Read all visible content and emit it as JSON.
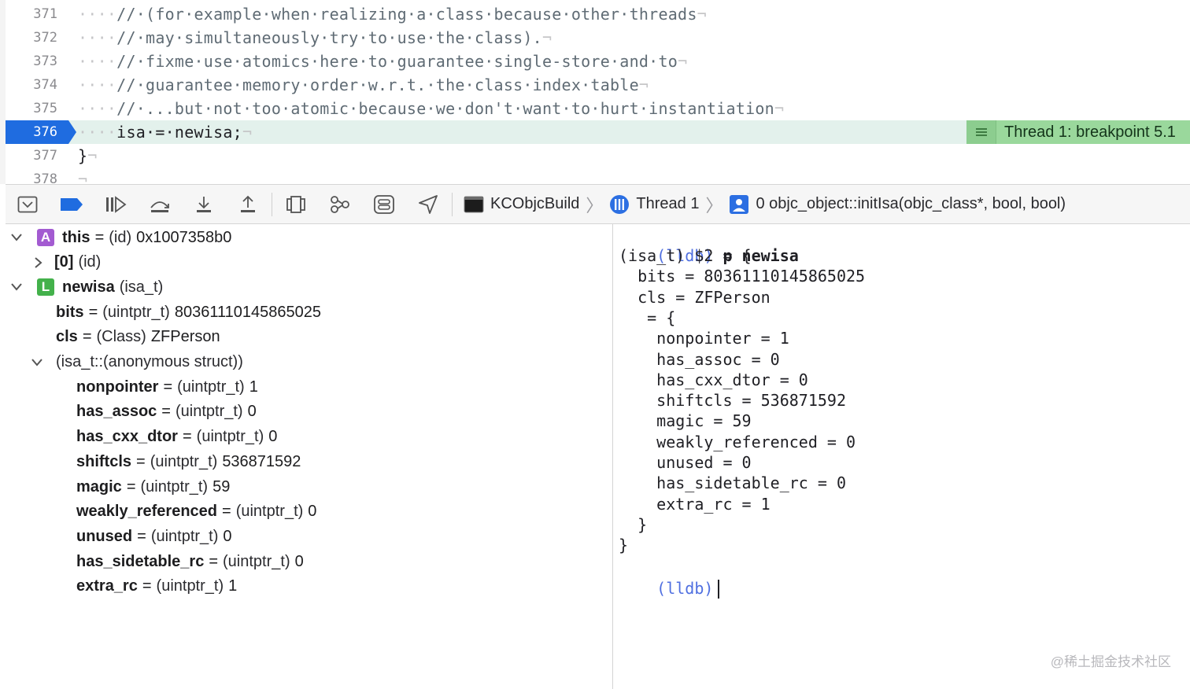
{
  "editor": {
    "lines": [
      {
        "num": "371",
        "indent": "····",
        "code": "//·(for·example·when·realizing·a·class·because·other·threads",
        "eol": "¬"
      },
      {
        "num": "372",
        "indent": "····",
        "code": "//·may·simultaneously·try·to·use·the·class).",
        "eol": "¬"
      },
      {
        "num": "373",
        "indent": "····",
        "code": "//·fixme·use·atomics·here·to·guarantee·single-store·and·to",
        "eol": "¬"
      },
      {
        "num": "374",
        "indent": "····",
        "code": "//·guarantee·memory·order·w.r.t.·the·class·index·table",
        "eol": "¬"
      },
      {
        "num": "375",
        "indent": "····",
        "code": "//·...but·not·too·atomic·because·we·don't·want·to·hurt·instantiation",
        "eol": "¬"
      },
      {
        "num": "376",
        "indent": "····",
        "code": "isa·=·newisa;",
        "eol": "¬"
      },
      {
        "num": "377",
        "indent": "",
        "code": "}",
        "eol": "¬"
      },
      {
        "num": "378",
        "indent": "",
        "code": "",
        "eol": "¬"
      }
    ],
    "current_line": "376",
    "breakpoint_label": "Thread 1: breakpoint 5.1",
    "colors": {
      "accent": "#1f6ce0",
      "current_line_bg": "#e3f1ec",
      "annotation_bg": "#9ad89c"
    }
  },
  "debugbar": {
    "buttons": [
      {
        "name": "hide-debug-area-button",
        "icon": "hide-debug-area-icon"
      },
      {
        "name": "toggle-breakpoints-button",
        "icon": "breakpoint-icon"
      },
      {
        "name": "continue-button",
        "icon": "continue-icon"
      },
      {
        "name": "step-over-button",
        "icon": "step-over-icon"
      },
      {
        "name": "step-into-button",
        "icon": "step-into-icon"
      },
      {
        "name": "step-out-button",
        "icon": "step-out-icon"
      },
      {
        "name": "view-debugger-button",
        "icon": "view-debugger-icon"
      },
      {
        "name": "memory-graph-button",
        "icon": "memory-graph-icon"
      },
      {
        "name": "environment-overrides-button",
        "icon": "environment-overrides-icon"
      },
      {
        "name": "simulate-location-button",
        "icon": "location-icon"
      }
    ],
    "breadcrumb": {
      "target": "KCObjcBuild",
      "thread": "Thread 1",
      "frame": "0 objc_object::initIsa(objc_class*, bool, bool)"
    }
  },
  "variables": [
    {
      "badge": "A",
      "name": "this",
      "type": "(id)",
      "value": "0x1007358b0",
      "expanded": true
    },
    {
      "name": "[0]",
      "type": "(id)",
      "value": "",
      "expanded": false
    },
    {
      "badge": "L",
      "name": "newisa",
      "type": "(isa_t)",
      "value": "",
      "expanded": true
    },
    {
      "name": "bits",
      "type": "(uintptr_t)",
      "value": "8036111014586502​5"
    },
    {
      "name": "cls",
      "type": "(Class)",
      "value": "ZFPerson"
    },
    {
      "name": "",
      "type": "(isa_t::(anonymous struct))",
      "value": "",
      "expanded": true
    },
    {
      "name": "nonpointer",
      "type": "(uintptr_t)",
      "value": "1"
    },
    {
      "name": "has_assoc",
      "type": "(uintptr_t)",
      "value": "0"
    },
    {
      "name": "has_cxx_dtor",
      "type": "(uintptr_t)",
      "value": "0"
    },
    {
      "name": "shiftcls",
      "type": "(uintptr_t)",
      "value": "536871592"
    },
    {
      "name": "magic",
      "type": "(uintptr_t)",
      "value": "59"
    },
    {
      "name": "weakly_referenced",
      "type": "(uintptr_t)",
      "value": "0"
    },
    {
      "name": "unused",
      "type": "(uintptr_t)",
      "value": "0"
    },
    {
      "name": "has_sidetable_rc",
      "type": "(uintptr_t)",
      "value": "0"
    },
    {
      "name": "extra_rc",
      "type": "(uintptr_t)",
      "value": "1"
    }
  ],
  "console": {
    "prompt": "(lldb)",
    "command": "p newisa",
    "output": [
      "(isa_t) $2 = {",
      "  bits = 80361110145865025",
      "  cls = ZFPerson",
      "   = {",
      "    nonpointer = 1",
      "    has_assoc = 0",
      "    has_cxx_dtor = 0",
      "    shiftcls = 536871592",
      "    magic = 59",
      "    weakly_referenced = 0",
      "    unused = 0",
      "    has_sidetable_rc = 0",
      "    extra_rc = 1",
      "  }",
      "}"
    ],
    "prompt2": "(lldb)",
    "watermark": "@稀土掘金技术社区"
  }
}
